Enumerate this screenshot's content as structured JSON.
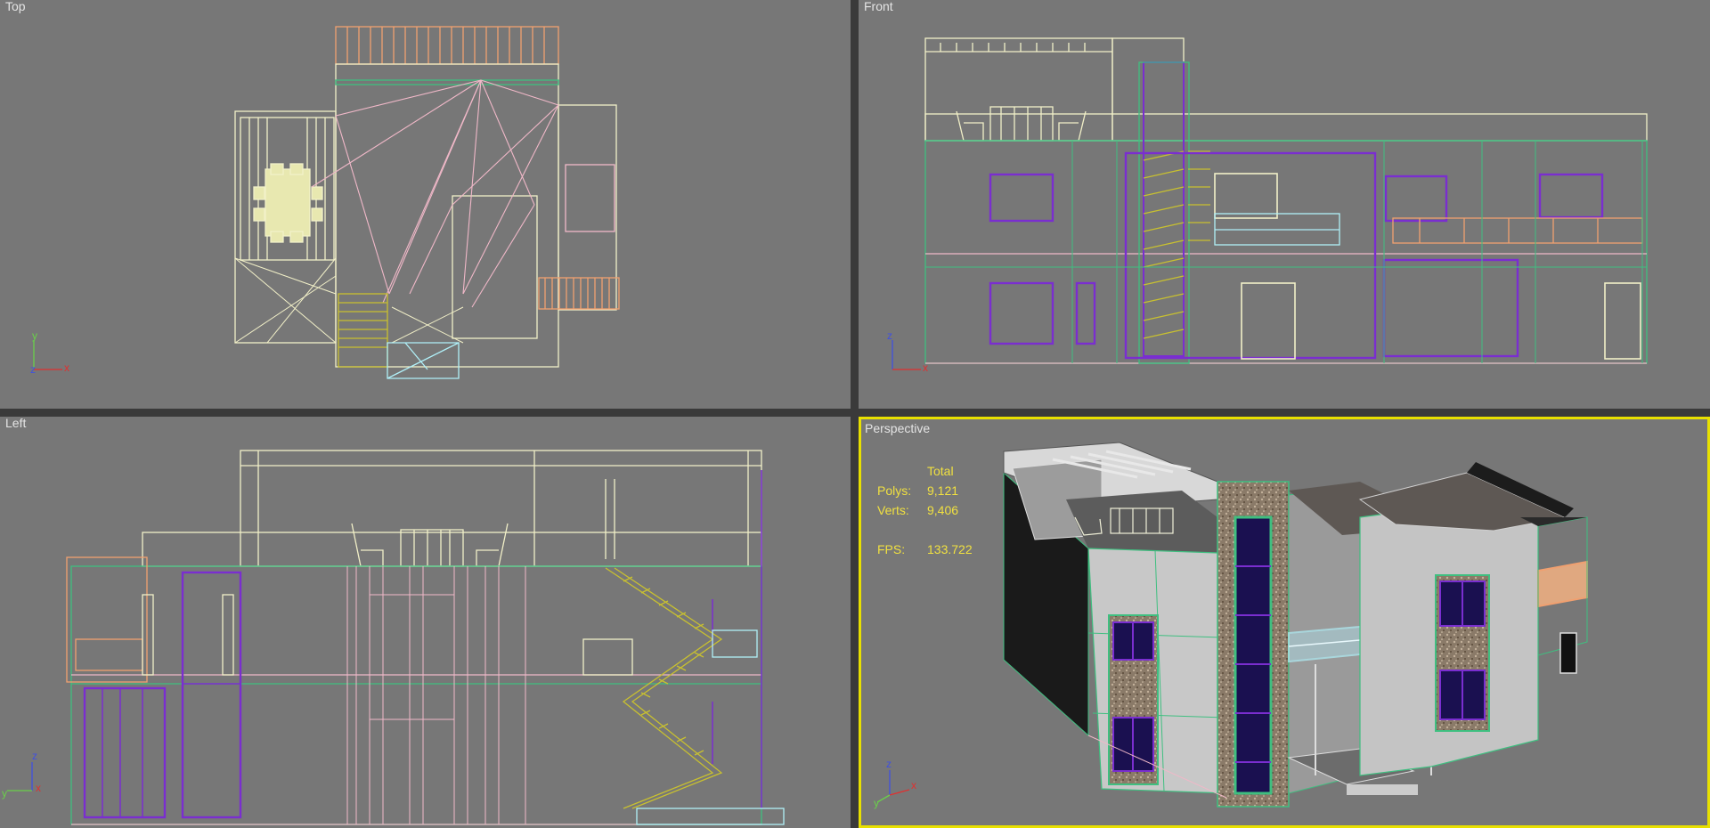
{
  "viewports": {
    "top": {
      "label": "Top"
    },
    "front": {
      "label": "Front"
    },
    "left": {
      "label": "Left"
    },
    "perspective": {
      "label": "Perspective"
    }
  },
  "stats": {
    "header": "Total",
    "polys_label": "Polys:",
    "polys_value": "9,121",
    "verts_label": "Verts:",
    "verts_value": "9,406",
    "fps_label": "FPS:",
    "fps_value": "133.722"
  },
  "axes": {
    "top": {
      "a": "y",
      "b": "z",
      "c": "x"
    },
    "front": {
      "a": "z",
      "c": "x"
    },
    "left": {
      "a": "z",
      "b": "y",
      "c": "x"
    },
    "perspective": {
      "a": "z",
      "b": "y",
      "c": "x"
    }
  },
  "colors": {
    "viewport_bg": "#777777",
    "active_border": "#e8e000",
    "wire_cream": "#f2f0c8",
    "wire_pink": "#f0b8c8",
    "wire_green": "#3fbf80",
    "wire_purple": "#7a2ed0",
    "wire_orange": "#f0a070",
    "wire_olive": "#c8c030",
    "wire_cyan": "#b0f0f8",
    "stats_text": "#f0e040"
  }
}
